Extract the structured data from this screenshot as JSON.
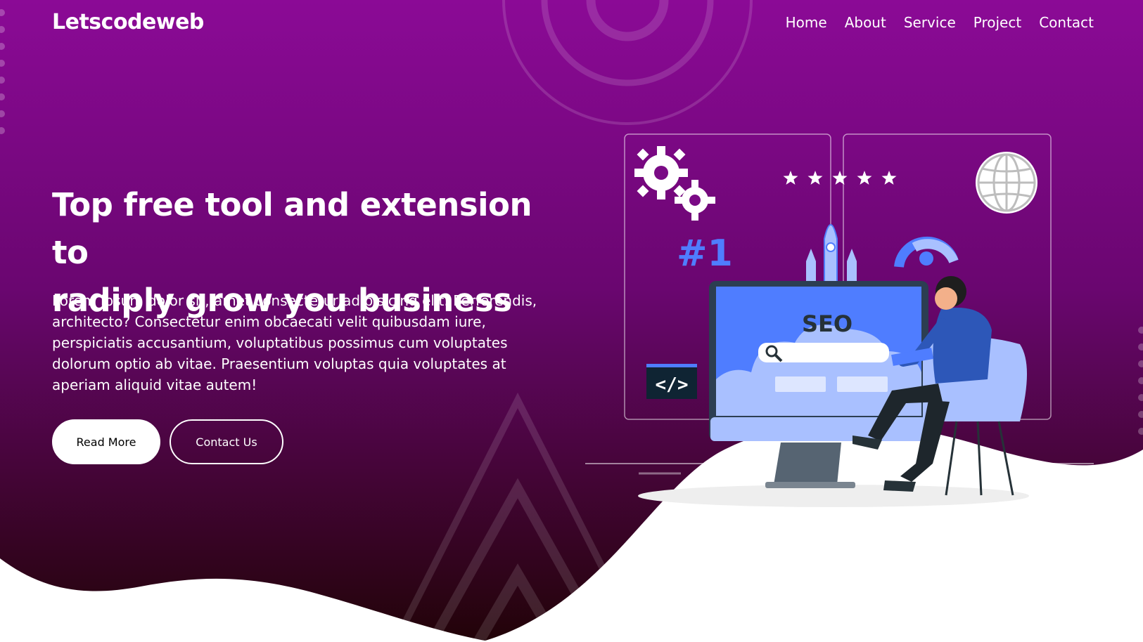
{
  "brand": {
    "name": "Letscodeweb"
  },
  "nav": {
    "items": [
      "Home",
      "About",
      "Service",
      "Project",
      "Contact"
    ]
  },
  "hero": {
    "headline_line1": "Top free tool and extension to",
    "headline_line2": "radiply grow you business",
    "description": "Lorem ipsum dolor sit, amet consectetur adipisicing elit. Perferendis, architecto? Consectetur enim obcaecati velit quibusdam iure, perspiciatis accusantium, voluptatibus possimus cum voluptates dolorum optio ab vitae. Praesentium voluptas quia voluptates at aperiam aliquid vitae autem!",
    "read_more_label": "Read More",
    "contact_label": "Contact Us"
  },
  "illustration": {
    "rank_label": "#1",
    "seo_label": "SEO",
    "code_label": "</>",
    "rating_stars": 5
  },
  "colors": {
    "gradient_top": "#8b0a96",
    "gradient_bottom": "#2a0410",
    "accent_blue": "#4f7dff",
    "light_blue": "#a9c0ff"
  }
}
